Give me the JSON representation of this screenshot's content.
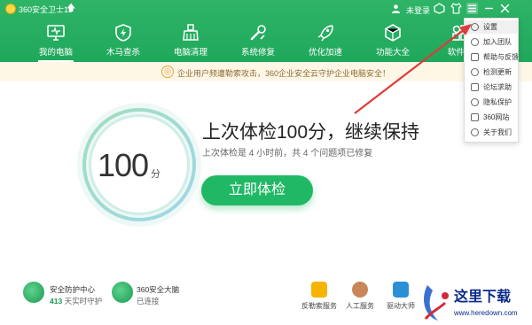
{
  "titlebar": {
    "app_title": "360安全卫士13",
    "upgrade_icon": "up-arrow-icon",
    "login_text": "未登录",
    "icons": [
      "user-icon",
      "skin-icon",
      "shirt-icon",
      "menu-icon",
      "minimize-icon",
      "close-icon"
    ]
  },
  "nav": {
    "items": [
      {
        "label": "我的电脑",
        "icon": "monitor-icon"
      },
      {
        "label": "木马查杀",
        "icon": "shield-bolt-icon"
      },
      {
        "label": "电脑清理",
        "icon": "broom-icon"
      },
      {
        "label": "系统修复",
        "icon": "wrench-icon"
      },
      {
        "label": "优化加速",
        "icon": "rocket-icon"
      },
      {
        "label": "功能大全",
        "icon": "cube-icon"
      },
      {
        "label": "软件管",
        "icon": "apps-icon"
      }
    ]
  },
  "notice": {
    "text": "企业用户频遭勒索攻击，360企业安全云守护企业电脑安全！"
  },
  "score": {
    "value": "100",
    "unit": "分",
    "headline": "上次体检100分，继续保持",
    "subline": "上次体检是 4 小时前，共 4 个问题项已修复",
    "button": "立即体检"
  },
  "bottom": {
    "defense": {
      "title": "安全防护中心",
      "days": "413",
      "days_label": "天实时守护"
    },
    "brain": {
      "title": "360安全大脑",
      "status": "已连接"
    },
    "tools": [
      {
        "label": "反勒索服务",
        "color": "#f5b400"
      },
      {
        "label": "人工服务",
        "color": "#c8865a"
      },
      {
        "label": "驱动大师",
        "color": "#2b8fd6"
      }
    ]
  },
  "menu": {
    "items": [
      "设置",
      "加入团队",
      "帮助与反馈",
      "检测更新",
      "论坛求助",
      "隐私保护",
      "360网站",
      "关于我们"
    ]
  },
  "watermark": {
    "title": "这里下载",
    "url": "www.heredown.com"
  },
  "colors": {
    "brand_green": "#21b865",
    "header_green": "#2fb467",
    "arrow_red": "#e03a3a"
  }
}
